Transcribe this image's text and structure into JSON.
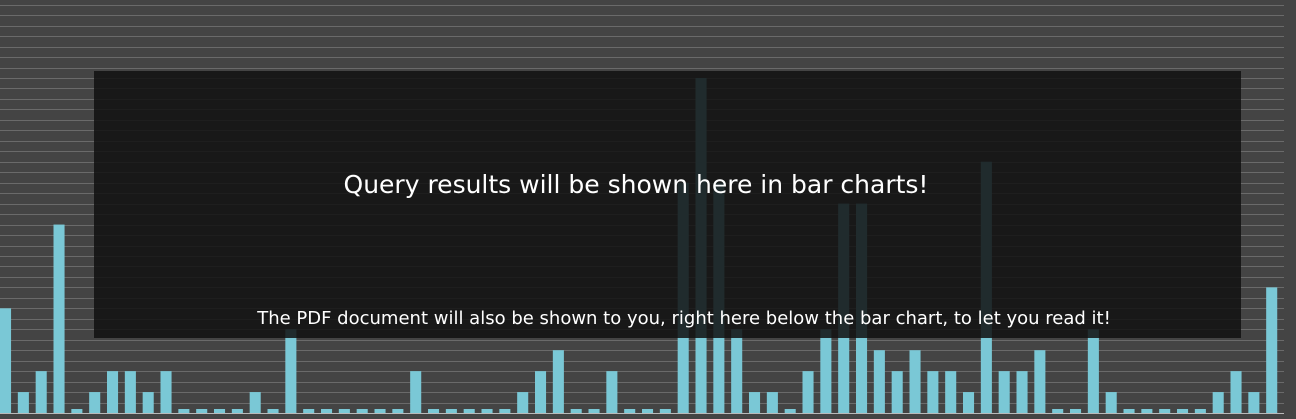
{
  "overlay": {
    "headline": "Query results will be shown here in bar charts!",
    "subline": "The PDF document will also be shown to you, right here below the bar chart, to let you read it!"
  },
  "colors": {
    "background": "#444444",
    "bar": "#7ac8d6",
    "overlay": "#121212",
    "text": "#ffffff"
  },
  "chart_data": {
    "type": "bar",
    "title": "",
    "xlabel": "",
    "ylabel": "",
    "ylim": [
      0,
      16
    ],
    "grid": true,
    "values": [
      5,
      1,
      2,
      9,
      0,
      1,
      2,
      2,
      1,
      2,
      0,
      0,
      0,
      0,
      1,
      0,
      4,
      0,
      0,
      0,
      0,
      0,
      0,
      2,
      0,
      0,
      0,
      0,
      0,
      1,
      2,
      3,
      0,
      0,
      2,
      0,
      0,
      0,
      11,
      16,
      11,
      4,
      1,
      1,
      0,
      2,
      4,
      10,
      10,
      3,
      2,
      3,
      2,
      2,
      1,
      12,
      2,
      2,
      3,
      0,
      0,
      4,
      1,
      0,
      0,
      0,
      0,
      0,
      1,
      2,
      1,
      6
    ]
  }
}
